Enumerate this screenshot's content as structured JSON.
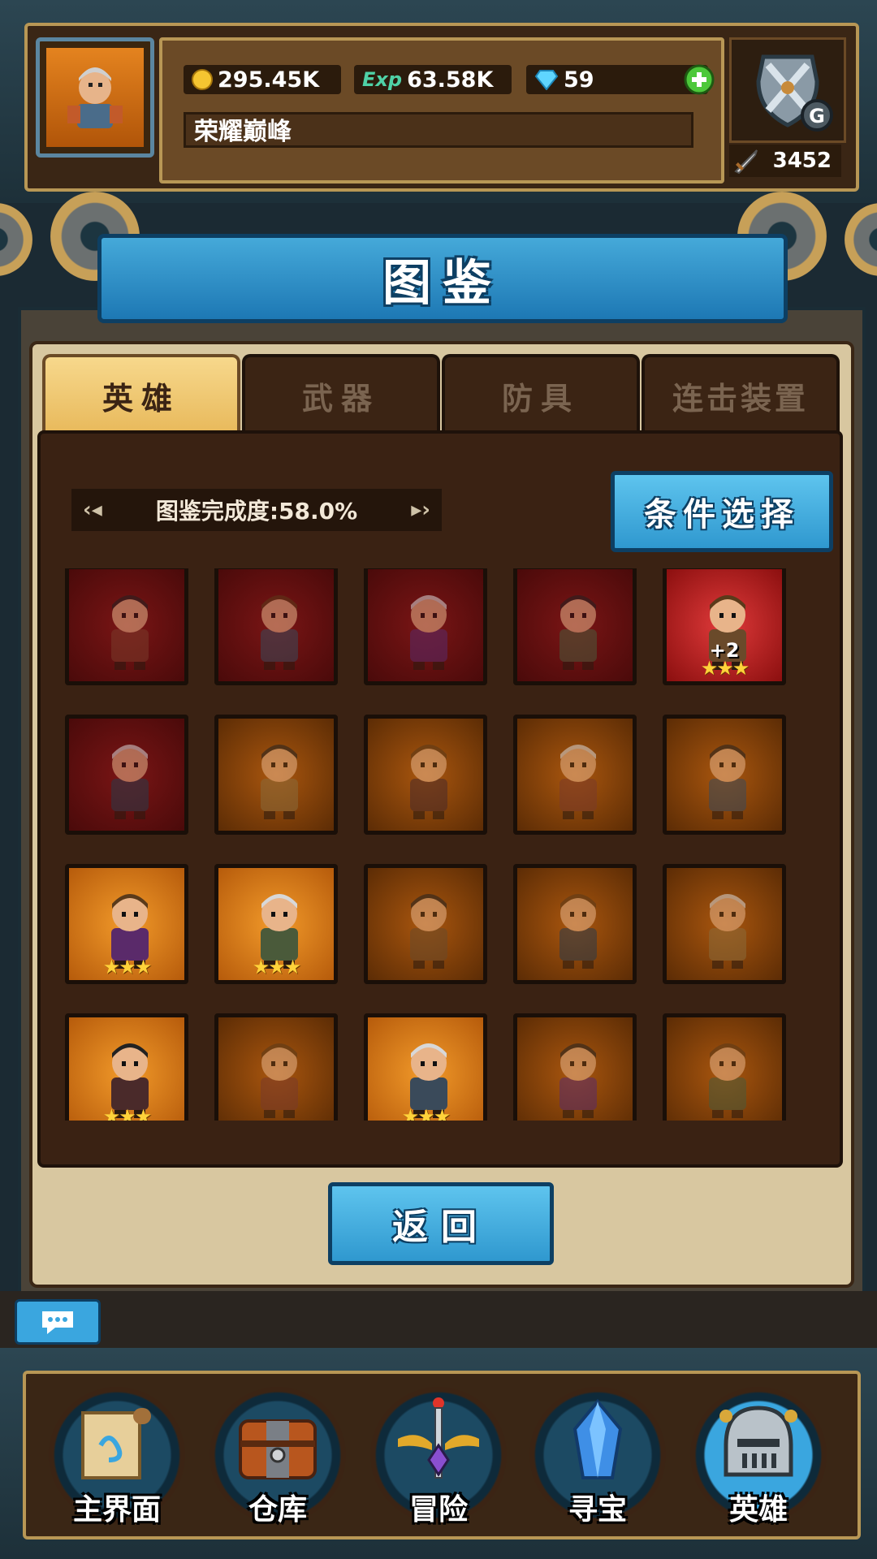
{
  "header": {
    "gold": "295.45K",
    "exp_label": "Exp",
    "exp": "63.58K",
    "gems": "59",
    "guild_name": "荣耀巅峰",
    "rank_badge": "G",
    "power": "3452"
  },
  "panel": {
    "title": "图鉴",
    "tabs": [
      {
        "label": "英雄",
        "active": true
      },
      {
        "label": "武器",
        "active": false
      },
      {
        "label": "防具",
        "active": false
      },
      {
        "label": "连击装置",
        "active": false
      }
    ],
    "completion": "图鉴完成度:58.0%",
    "filter_button": "条件选择",
    "back_button": "返回"
  },
  "heroes": [
    {
      "frame": "red",
      "owned": false,
      "stars": 0
    },
    {
      "frame": "red",
      "owned": false,
      "stars": 0
    },
    {
      "frame": "red",
      "owned": false,
      "stars": 0
    },
    {
      "frame": "red",
      "owned": false,
      "stars": 0
    },
    {
      "frame": "red",
      "owned": true,
      "stars": 3,
      "bonus": "+2"
    },
    {
      "frame": "red",
      "owned": false,
      "stars": 0
    },
    {
      "frame": "orange",
      "owned": false,
      "stars": 0
    },
    {
      "frame": "orange",
      "owned": false,
      "stars": 0
    },
    {
      "frame": "orange",
      "owned": false,
      "stars": 0
    },
    {
      "frame": "orange",
      "owned": false,
      "stars": 0
    },
    {
      "frame": "orange",
      "owned": true,
      "stars": 3
    },
    {
      "frame": "orange",
      "owned": true,
      "stars": 3
    },
    {
      "frame": "orange",
      "owned": false,
      "stars": 0
    },
    {
      "frame": "orange",
      "owned": false,
      "stars": 0
    },
    {
      "frame": "orange",
      "owned": false,
      "stars": 0
    },
    {
      "frame": "orange",
      "owned": true,
      "stars": 3
    },
    {
      "frame": "orange",
      "owned": false,
      "stars": 0
    },
    {
      "frame": "orange",
      "owned": true,
      "stars": 3
    },
    {
      "frame": "orange",
      "owned": false,
      "stars": 0
    },
    {
      "frame": "orange",
      "owned": false,
      "stars": 0
    }
  ],
  "star_glyph": "★★★",
  "bottom_nav": [
    {
      "label": "主界面",
      "icon": "scroll-icon"
    },
    {
      "label": "仓库",
      "icon": "chest-icon"
    },
    {
      "label": "冒险",
      "icon": "sword-emblem-icon"
    },
    {
      "label": "寻宝",
      "icon": "crystal-icon"
    },
    {
      "label": "英雄",
      "icon": "helmet-icon"
    }
  ],
  "colors": {
    "accent_blue": "#2f98cf",
    "panel_tan": "#d8c7a0",
    "frame_gold": "#b89755",
    "star_yellow": "#ffd23a"
  }
}
